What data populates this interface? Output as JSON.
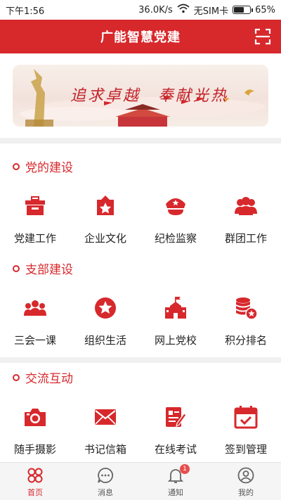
{
  "status_bar": {
    "time": "下午1:56",
    "network_speed": "36.0K/s",
    "sim": "无SIM卡",
    "battery": "65%",
    "battery_level": 0.65
  },
  "header": {
    "title": "广能智慧党建",
    "scan_icon": "scan-icon"
  },
  "banner": {
    "slogan": "追求卓越　奉献光热"
  },
  "sections": [
    {
      "title": "党的建设",
      "items": [
        {
          "label": "党建工作",
          "icon": "briefcase-icon"
        },
        {
          "label": "企业文化",
          "icon": "star-badge-icon"
        },
        {
          "label": "纪检监察",
          "icon": "police-cap-icon"
        },
        {
          "label": "群团工作",
          "icon": "group-icon"
        }
      ]
    },
    {
      "title": "支部建设",
      "items": [
        {
          "label": "三会一课",
          "icon": "people-meeting-icon"
        },
        {
          "label": "组织生活",
          "icon": "star-circle-icon"
        },
        {
          "label": "网上党校",
          "icon": "school-icon"
        },
        {
          "label": "积分排名",
          "icon": "coins-icon"
        }
      ]
    },
    {
      "title": "交流互动",
      "items": [
        {
          "label": "随手摄影",
          "icon": "camera-icon"
        },
        {
          "label": "书记信箱",
          "icon": "envelope-icon"
        },
        {
          "label": "在线考试",
          "icon": "exam-icon"
        },
        {
          "label": "签到管理",
          "icon": "calendar-check-icon"
        }
      ]
    }
  ],
  "tab_bar": {
    "tabs": [
      {
        "label": "首页",
        "icon": "home-clover-icon",
        "active": true
      },
      {
        "label": "消息",
        "icon": "message-icon",
        "active": false
      },
      {
        "label": "通知",
        "icon": "bell-icon",
        "active": false,
        "badge": "1"
      },
      {
        "label": "我的",
        "icon": "profile-icon",
        "active": false
      }
    ]
  },
  "colors": {
    "primary_red": "#d7282c",
    "background": "#ffffff",
    "divider": "#f0f0f0"
  }
}
